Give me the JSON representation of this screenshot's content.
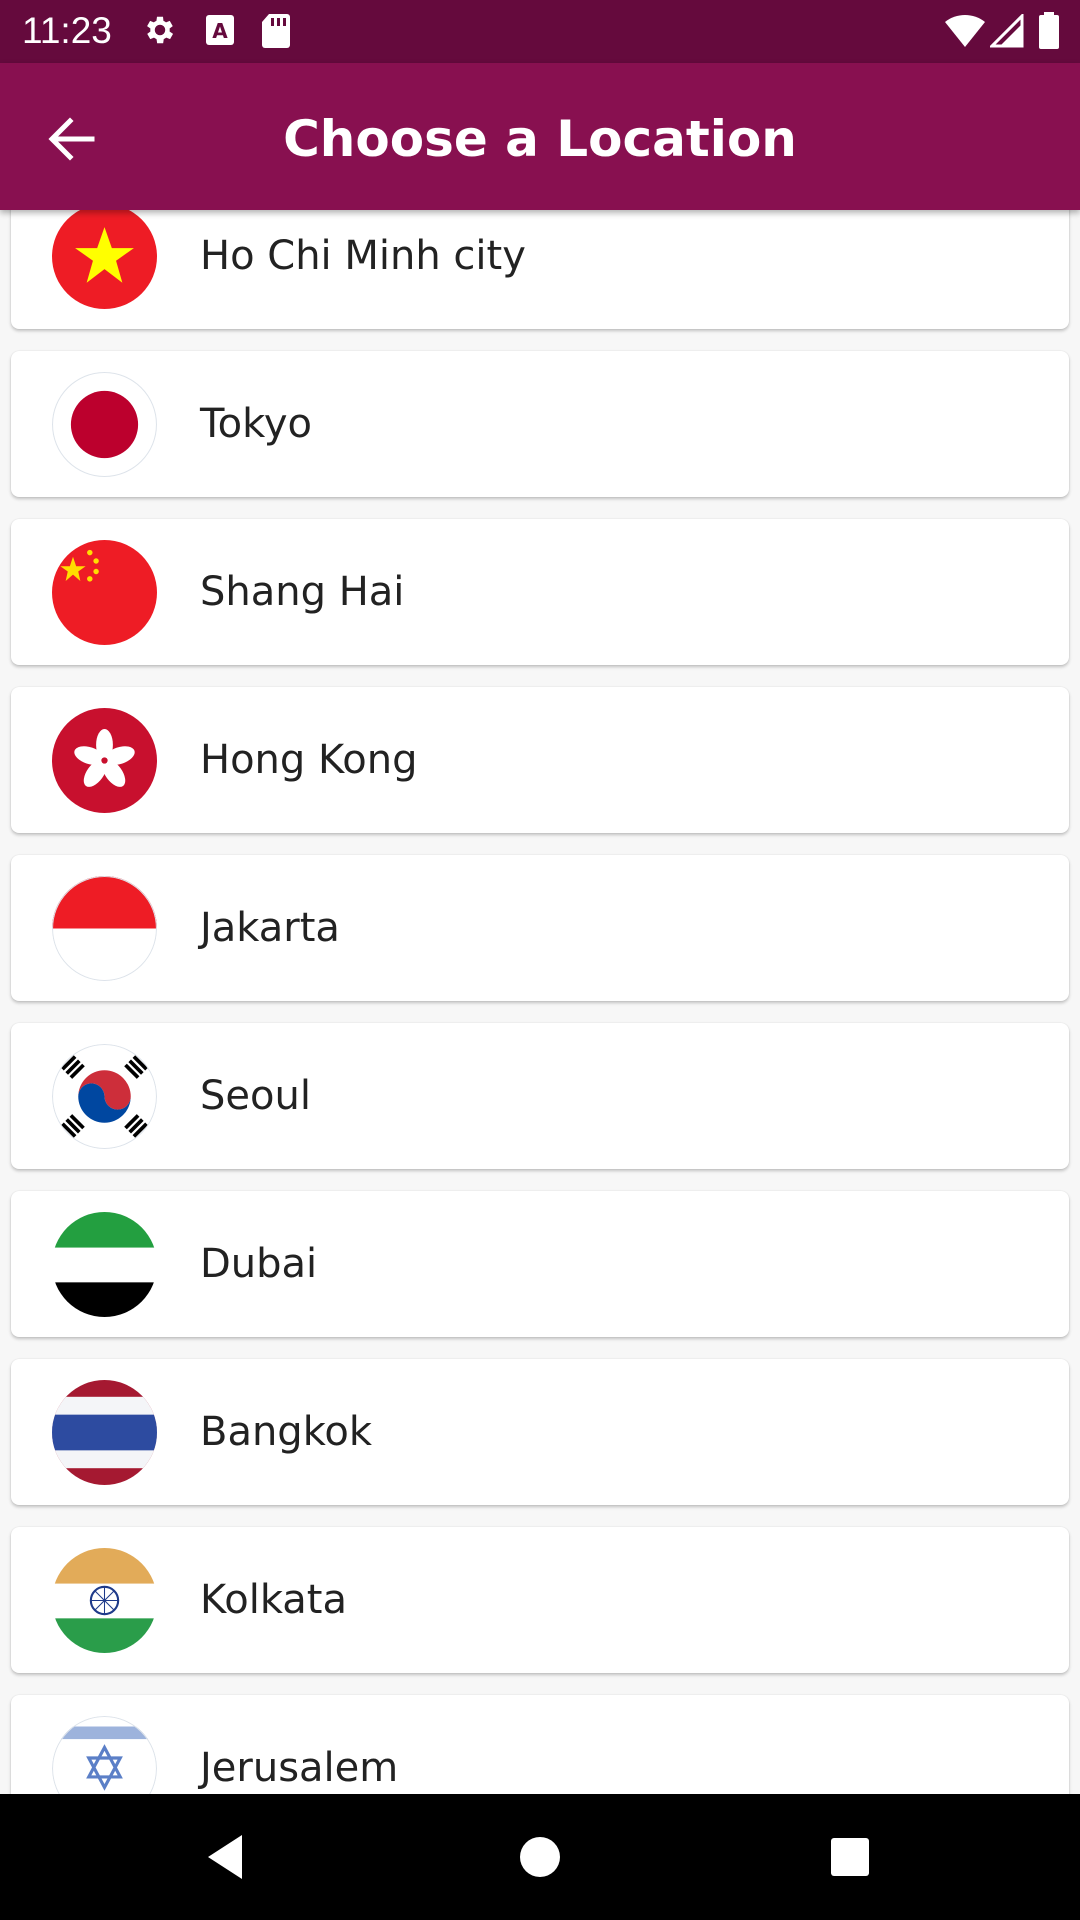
{
  "status_bar": {
    "time": "11:23",
    "left_icons": [
      "gear-icon",
      "a-icon",
      "sd-card-icon"
    ],
    "right_icons": [
      "wifi-icon",
      "signal-icon",
      "battery-icon"
    ]
  },
  "app_bar": {
    "title": "Choose a Location",
    "back_icon": "arrow-left-icon"
  },
  "locations": [
    {
      "name": "Ho Chi Minh city",
      "flag": "vietnam-flag-icon"
    },
    {
      "name": "Tokyo",
      "flag": "japan-flag-icon"
    },
    {
      "name": "Shang Hai",
      "flag": "china-flag-icon"
    },
    {
      "name": "Hong Kong",
      "flag": "hong-kong-flag-icon"
    },
    {
      "name": "Jakarta",
      "flag": "indonesia-flag-icon"
    },
    {
      "name": "Seoul",
      "flag": "south-korea-flag-icon"
    },
    {
      "name": "Dubai",
      "flag": "uae-flag-icon"
    },
    {
      "name": "Bangkok",
      "flag": "thailand-flag-icon"
    },
    {
      "name": "Kolkata",
      "flag": "india-flag-icon"
    },
    {
      "name": "Jerusalem",
      "flag": "israel-flag-icon"
    }
  ],
  "nav_bar": {
    "buttons": [
      "back-triangle-icon",
      "home-circle-icon",
      "recents-square-icon"
    ]
  },
  "colors": {
    "status_bar": "#650a3d",
    "app_bar": "#881050",
    "background": "#f7f7f7",
    "card": "#ffffff"
  }
}
